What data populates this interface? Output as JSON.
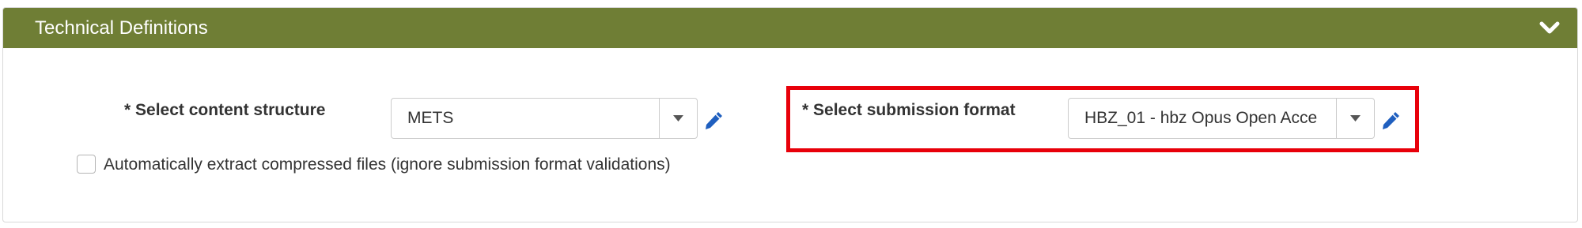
{
  "panel": {
    "title": "Technical Definitions",
    "collapse_icon": "chevron-down-icon",
    "header_color": "#6f7e35"
  },
  "content_structure": {
    "required_mark": "*",
    "label": "Select content structure",
    "selected_value": "METS",
    "edit_icon": "pencil-icon"
  },
  "submission_format": {
    "required_mark": "*",
    "label": "Select submission format",
    "selected_value": "HBZ_01 - hbz Opus Open Acce",
    "edit_icon": "pencil-icon",
    "highlight_color": "#e8000a"
  },
  "auto_extract": {
    "checked": false,
    "label": "Automatically extract compressed files (ignore submission format validations)"
  }
}
